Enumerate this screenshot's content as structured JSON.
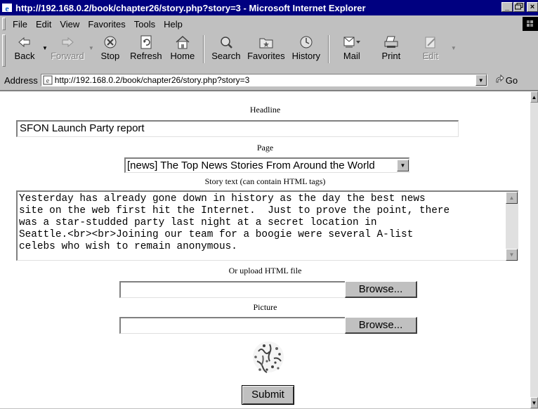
{
  "window": {
    "title": "http://192.168.0.2/book/chapter26/story.php?story=3 - Microsoft Internet Explorer",
    "controls": [
      "_",
      "▫",
      "×"
    ]
  },
  "menu": {
    "items": [
      {
        "label": "File",
        "key": "F"
      },
      {
        "label": "Edit",
        "key": "E"
      },
      {
        "label": "View",
        "key": "V"
      },
      {
        "label": "Favorites",
        "key": "a"
      },
      {
        "label": "Tools",
        "key": "T"
      },
      {
        "label": "Help",
        "key": "H"
      }
    ]
  },
  "toolbar": {
    "back": "Back",
    "forward": "Forward",
    "stop": "Stop",
    "refresh": "Refresh",
    "home": "Home",
    "search": "Search",
    "favorites": "Favorites",
    "history": "History",
    "mail": "Mail",
    "print": "Print",
    "edit": "Edit"
  },
  "address": {
    "label": "Address",
    "url": "http://192.168.0.2/book/chapter26/story.php?story=3",
    "go": "Go"
  },
  "form": {
    "headline_label": "Headline",
    "headline_value": "SFON Launch Party report",
    "page_label": "Page",
    "page_value": "[news] The Top News Stories From Around the World",
    "story_label": "Story text (can contain HTML tags)",
    "story_text": "Yesterday has already gone down in history as the day the best news\nsite on the web first hit the Internet.  Just to prove the point, there\nwas a star-studded party last night at a secret location in\nSeattle.<br><br>Joining our team for a boogie were several A-list\ncelebs who wish to remain anonymous.",
    "upload_label": "Or upload HTML file",
    "upload_value": "",
    "browse_label": "Browse...",
    "picture_label": "Picture",
    "picture_value": "",
    "browse2_label": "Browse...",
    "submit_label": "Submit"
  },
  "colors": {
    "titlebar": "#000080",
    "chrome": "#c0c0c0",
    "page_bg": "#ffffff"
  }
}
